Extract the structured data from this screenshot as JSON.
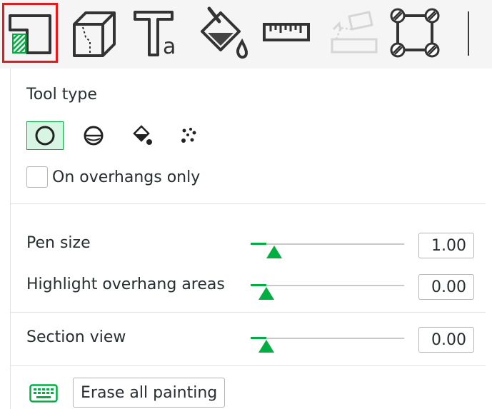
{
  "toolbar": {
    "tools": [
      {
        "icon": "support-paint-icon",
        "selected": true
      },
      {
        "icon": "cut-cube-icon"
      },
      {
        "icon": "text-icon",
        "glyph": "a"
      },
      {
        "icon": "color-paint-icon"
      },
      {
        "icon": "ruler-icon"
      },
      {
        "icon": "assembly-icon",
        "disabled": true
      },
      {
        "icon": "brim-ears-icon"
      }
    ]
  },
  "panel": {
    "tool_type_label": "Tool type",
    "tool_types": [
      {
        "icon": "circle-icon",
        "active": true
      },
      {
        "icon": "sphere-icon"
      },
      {
        "icon": "fill-bucket-icon"
      },
      {
        "icon": "gap-fill-icon"
      }
    ],
    "overhangs_only_label": "On overhangs only",
    "overhangs_only_checked": false,
    "pen_size": {
      "label": "Pen size",
      "value": "1.00",
      "level": 0.1
    },
    "highlight_overhang": {
      "label": "Highlight overhang areas",
      "value": "0.00",
      "level": 0.05
    },
    "section_view": {
      "label": "Section view",
      "value": "0.00",
      "level": 0.05
    },
    "erase_label": "Erase all painting"
  },
  "colors": {
    "accent": "#00ae42",
    "selected_outline": "#e8191b"
  }
}
